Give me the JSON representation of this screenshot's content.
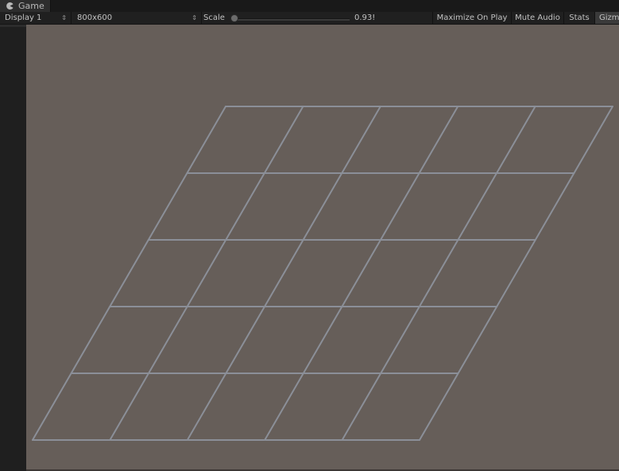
{
  "tab": {
    "title": "Game",
    "icon": "pacman-icon"
  },
  "toolbar": {
    "display": "Display 1",
    "resolution": "800x600",
    "scale_label": "Scale",
    "scale_value": "0.93!",
    "scale_fraction": 0.0,
    "maximize_label": "Maximize On Play",
    "mute_label": "Mute Audio",
    "stats_label": "Stats",
    "gizmos_label": "Gizm"
  },
  "scene": {
    "background_color": "#665e59",
    "grid_color": "#8b8f98",
    "grid_rows": 5,
    "grid_cols": 5
  }
}
